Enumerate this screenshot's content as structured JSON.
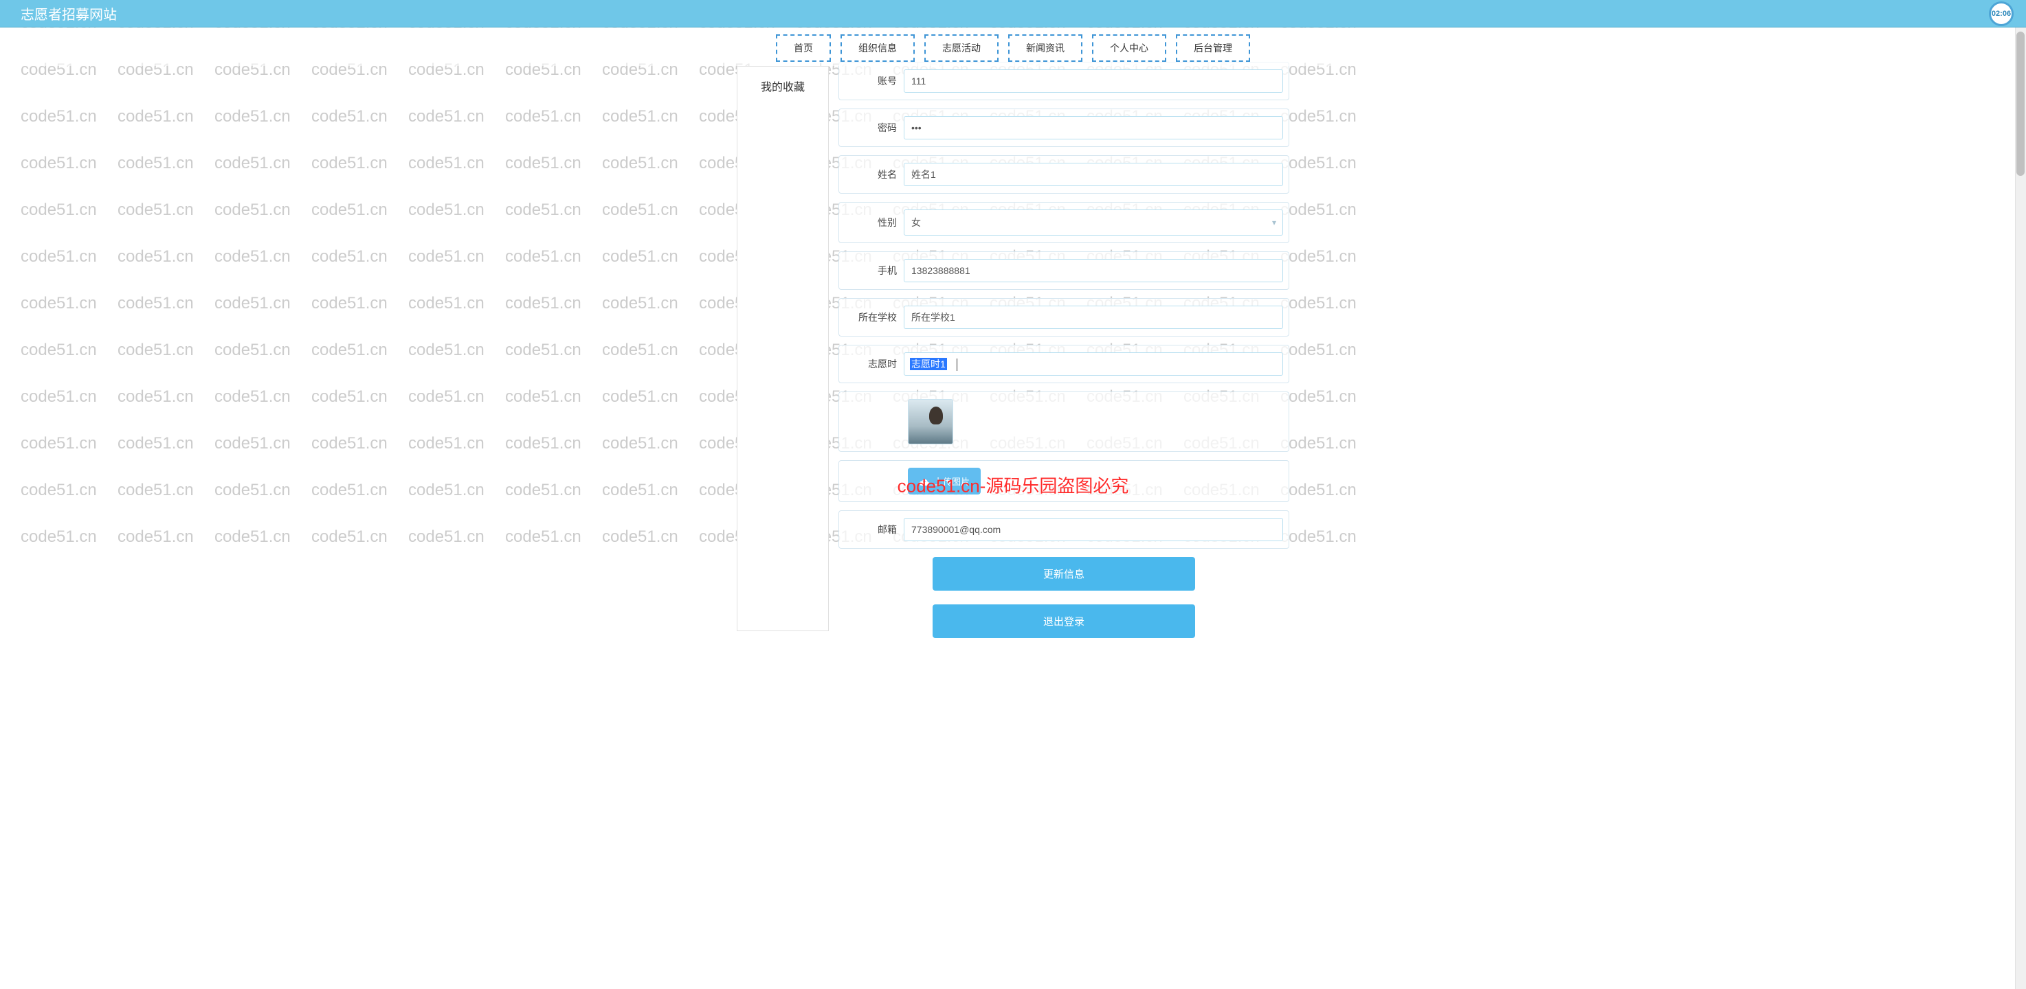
{
  "header": {
    "title": "志愿者招募网站",
    "timer": "02:06"
  },
  "nav": {
    "items": [
      "首页",
      "组织信息",
      "志愿活动",
      "新闻资讯",
      "个人中心",
      "后台管理"
    ]
  },
  "sidebar": {
    "title": "我的收藏"
  },
  "form": {
    "account": {
      "label": "账号",
      "value": "111"
    },
    "password": {
      "label": "密码",
      "value": "•••"
    },
    "name": {
      "label": "姓名",
      "value": "姓名1"
    },
    "gender": {
      "label": "性别",
      "value": "女"
    },
    "phone": {
      "label": "手机",
      "value": "13823888881"
    },
    "school": {
      "label": "所在学校",
      "value": "所在学校1"
    },
    "volunteer": {
      "label": "志愿时",
      "value": "志愿时1"
    },
    "upload": {
      "label": "上传图片"
    },
    "email": {
      "label": "邮箱",
      "value": "773890001@qq.com"
    }
  },
  "buttons": {
    "update": "更新信息",
    "logout": "退出登录"
  },
  "watermark": {
    "text": "code51.cn",
    "center": "code51.cn-源码乐园盗图必究"
  }
}
